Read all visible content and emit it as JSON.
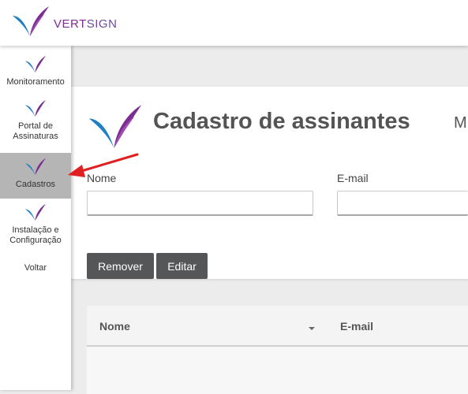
{
  "brand": {
    "name_part1": "VERT",
    "name_part2": "SIGN"
  },
  "sidebar": {
    "items": [
      {
        "label": "Monitoramento"
      },
      {
        "label": "Portal de Assinaturas"
      },
      {
        "label": "Cadastros",
        "active": true
      },
      {
        "label": "Instalação e Configuração"
      },
      {
        "label": "Voltar"
      }
    ]
  },
  "page": {
    "title": "Cadastro de assinantes",
    "title_extra": "M"
  },
  "form": {
    "name_label": "Nome",
    "name_value": "",
    "email_label": "E-mail",
    "email_value": ""
  },
  "actions": {
    "remove_label": "Remover",
    "edit_label": "Editar"
  },
  "table": {
    "columns": [
      "Nome",
      "E-mail"
    ],
    "rows": []
  },
  "colors": {
    "accent_purple": "#7b2d90",
    "accent_blue": "#1f7fc4",
    "button_bg": "#555657",
    "annotation_red": "#e02020"
  },
  "icons": {
    "logo": "vertsign-logo-icon",
    "annotation": "red-arrow-annotation"
  }
}
